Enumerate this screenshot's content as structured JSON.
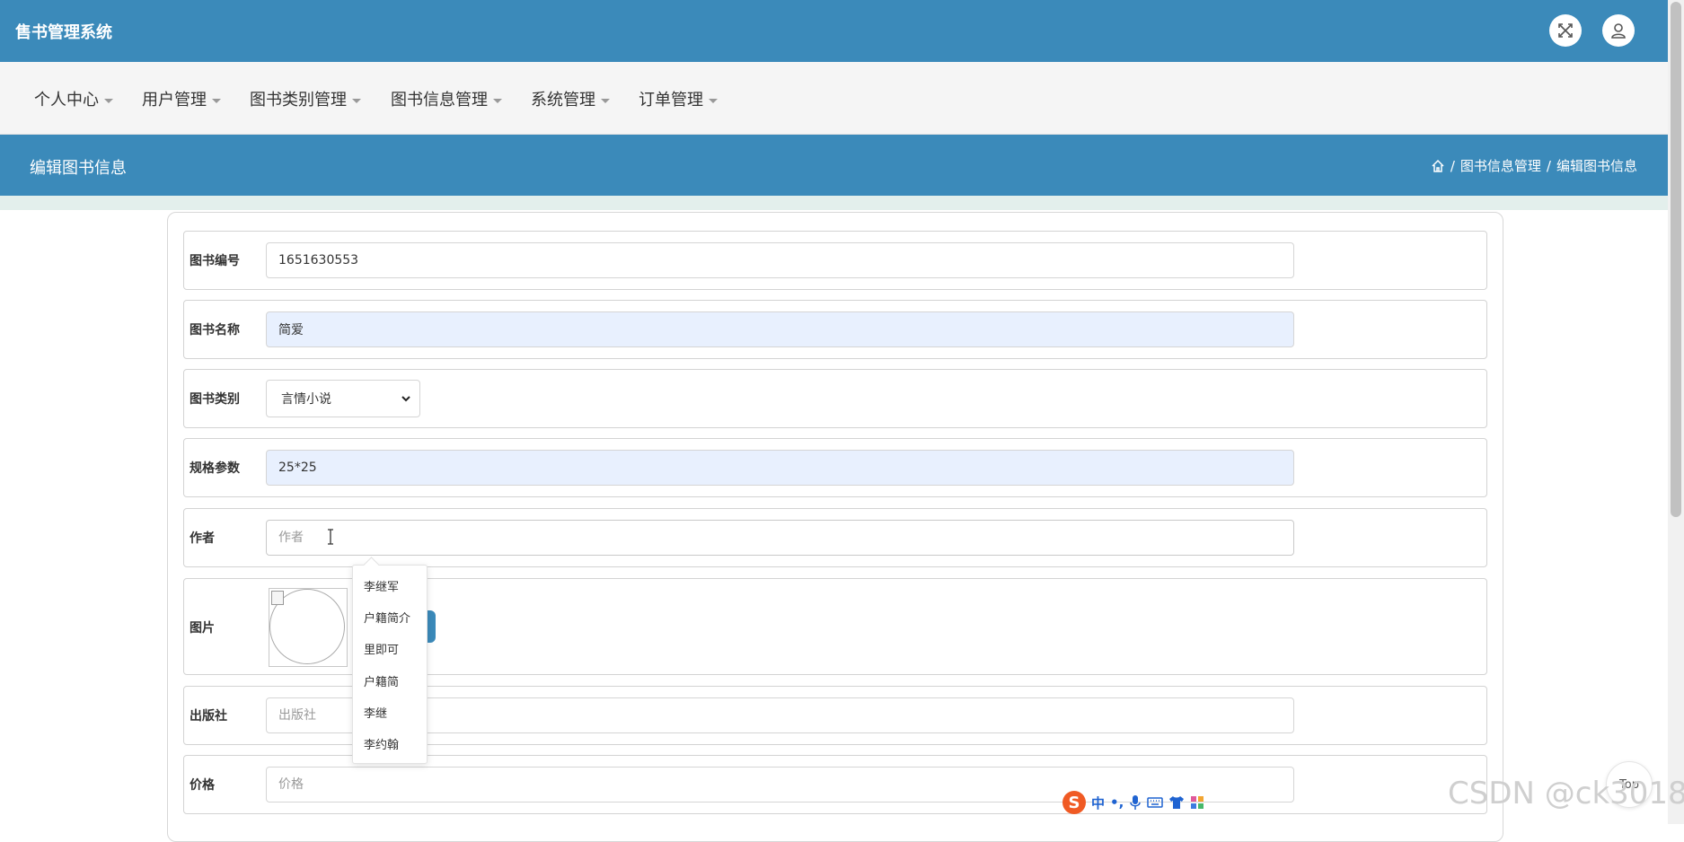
{
  "app": {
    "title": "售书管理系统"
  },
  "header_icons": {
    "fullscreen": "fullscreen-icon",
    "user": "user-icon"
  },
  "nav": {
    "items": [
      {
        "label": "个人中心"
      },
      {
        "label": "用户管理"
      },
      {
        "label": "图书类别管理"
      },
      {
        "label": "图书信息管理"
      },
      {
        "label": "系统管理"
      },
      {
        "label": "订单管理"
      }
    ]
  },
  "page": {
    "title": "编辑图书信息",
    "breadcrumb": {
      "home_icon": "home-icon",
      "section": "图书信息管理",
      "current": "编辑图书信息",
      "separator": "/"
    }
  },
  "form": {
    "book_no": {
      "label": "图书编号",
      "value": "1651630553"
    },
    "book_name": {
      "label": "图书名称",
      "value": "简爱"
    },
    "category": {
      "label": "图书类别",
      "value": "言情小说"
    },
    "spec": {
      "label": "规格参数",
      "value": "25*25"
    },
    "author": {
      "label": "作者",
      "placeholder": "作者",
      "value": ""
    },
    "image": {
      "label": "图片"
    },
    "publisher": {
      "label": "出版社",
      "placeholder": "出版社",
      "value": ""
    },
    "price": {
      "label": "价格",
      "placeholder": "价格",
      "value": ""
    }
  },
  "autocomplete": {
    "items": [
      "李继军",
      "户籍简介",
      "里即可",
      "户籍简",
      "李继",
      "李约翰"
    ]
  },
  "ime": {
    "mode": "中",
    "punct": "•,",
    "logo": "S"
  },
  "top_button": {
    "label": "Top"
  },
  "watermark": "CSDN @ck3018",
  "colors": {
    "primary": "#3b8aba",
    "nav_bg": "#f5f5f5",
    "autofill_bg": "#e8f0fe",
    "ime_orange": "#f05a24",
    "ime_blue": "#1f63d1"
  }
}
